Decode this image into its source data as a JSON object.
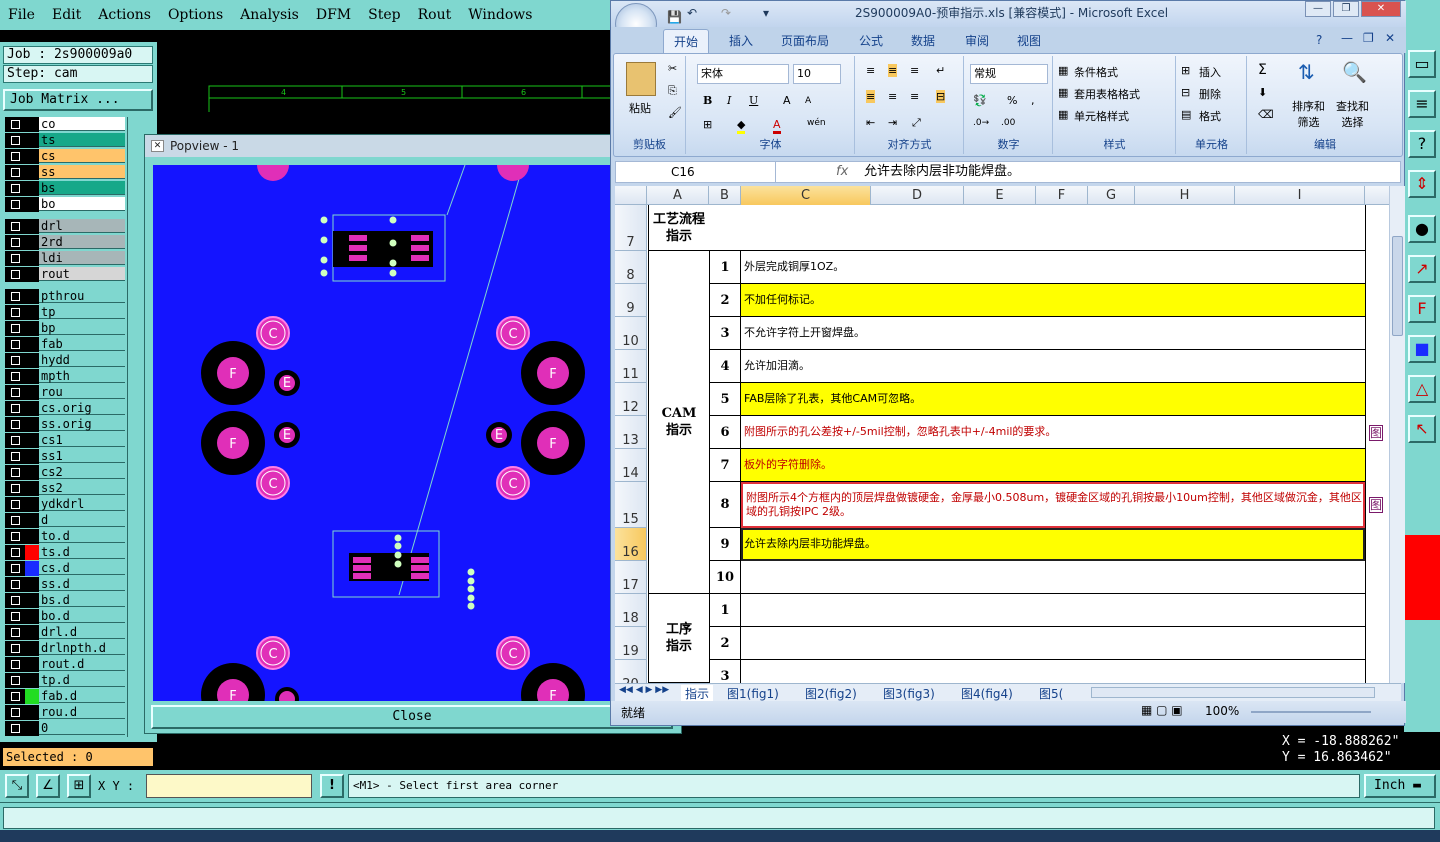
{
  "menubar": {
    "items": [
      "File",
      "Edit",
      "Actions",
      "Options",
      "Analysis",
      "DFM",
      "Step",
      "Rout",
      "Windows"
    ]
  },
  "job": {
    "job_label": "Job : 2s900009a0",
    "step_label": "Step: cam",
    "matrix_button": "Job Matrix ..."
  },
  "layers": [
    {
      "name": "co",
      "color": "#ffffff"
    },
    {
      "name": "ts",
      "color": "#17a889"
    },
    {
      "name": "cs",
      "color": "#ffc46b"
    },
    {
      "name": "ss",
      "color": "#ffc46b"
    },
    {
      "name": "bs",
      "color": "#17a889"
    },
    {
      "name": "bo",
      "color": "#ffffff"
    },
    {
      "name": "drl",
      "color": "#a7b6b8"
    },
    {
      "name": "2rd",
      "color": "#a7b6b8"
    },
    {
      "name": "ldi",
      "color": "#a7b6b8"
    },
    {
      "name": "rout",
      "color": "#d6d6d6"
    },
    {
      "name": "pthrou",
      "color": "#7fd7cf"
    },
    {
      "name": "tp",
      "color": "#7fd7cf"
    },
    {
      "name": "bp",
      "color": "#7fd7cf"
    },
    {
      "name": "fab",
      "color": "#7fd7cf",
      "pen": true
    },
    {
      "name": "hydd",
      "color": "#7fd7cf"
    },
    {
      "name": "mpth",
      "color": "#7fd7cf"
    },
    {
      "name": "rou",
      "color": "#7fd7cf",
      "pen": true
    },
    {
      "name": "cs.orig",
      "color": "#7fd7cf"
    },
    {
      "name": "ss.orig",
      "color": "#7fd7cf"
    },
    {
      "name": "cs1",
      "color": "#7fd7cf"
    },
    {
      "name": "ss1",
      "color": "#7fd7cf"
    },
    {
      "name": "cs2",
      "color": "#7fd7cf"
    },
    {
      "name": "ss2",
      "color": "#7fd7cf"
    },
    {
      "name": "ydkdrl",
      "color": "#7fd7cf"
    },
    {
      "name": "d",
      "color": "#7fd7cf"
    },
    {
      "name": "to.d",
      "color": "#7fd7cf"
    },
    {
      "name": "ts.d",
      "color": "#7fd7cf",
      "marker": "#ff0000"
    },
    {
      "name": "cs.d",
      "color": "#7fd7cf",
      "marker": "#1a2cff"
    },
    {
      "name": "ss.d",
      "color": "#7fd7cf"
    },
    {
      "name": "bs.d",
      "color": "#7fd7cf"
    },
    {
      "name": "bo.d",
      "color": "#7fd7cf"
    },
    {
      "name": "drl.d",
      "color": "#7fd7cf"
    },
    {
      "name": "drlnpth.d",
      "color": "#7fd7cf"
    },
    {
      "name": "rout.d",
      "color": "#7fd7cf"
    },
    {
      "name": "tp.d",
      "color": "#7fd7cf"
    },
    {
      "name": "fab.d",
      "color": "#7fd7cf",
      "marker": "#22dd22",
      "pen": true
    },
    {
      "name": "rou.d",
      "color": "#7fd7cf",
      "pen": true
    },
    {
      "name": "0",
      "color": "#7fd7cf"
    }
  ],
  "selected_label": "Selected : 0",
  "ruler": [
    "4",
    "5",
    "6"
  ],
  "popview": {
    "title": "Popview - 1",
    "close_label": "Close",
    "pad_labels": {
      "c": "C",
      "f": "F",
      "e": "E"
    }
  },
  "bottom": {
    "xy_label": "X Y :",
    "prompt": "<M1> - Select first area corner",
    "units": "Inch",
    "coord_x": "X = -18.888262\"",
    "coord_y": "Y = 16.863462\""
  },
  "excel": {
    "title": "2S900009A0-预审指示.xls  [兼容模式] - Microsoft Excel",
    "tabs": [
      "开始",
      "插入",
      "页面布局",
      "公式",
      "数据",
      "审阅",
      "视图"
    ],
    "groups": {
      "clipboard": "剪贴板",
      "font": "字体",
      "align": "对齐方式",
      "number": "数字",
      "style": "样式",
      "cells": "单元格",
      "edit": "编辑"
    },
    "paste": "粘贴",
    "font_name": "宋体",
    "font_size": "10",
    "number_format": "常规",
    "style_items": [
      "条件格式",
      "套用表格格式",
      "单元格样式"
    ],
    "cell_items": [
      "插入",
      "删除",
      "格式"
    ],
    "edit_items": [
      "排序和\n筛选",
      "查找和\n选择"
    ],
    "namebox": "C16",
    "fx": "fx",
    "formula": "允许去除内层非功能焊盘。",
    "columns": [
      "A",
      "B",
      "C",
      "D",
      "E",
      "F",
      "G",
      "H",
      "I"
    ],
    "rows": [
      {
        "num": "7",
        "h": "",
        "text": "",
        "fill": ""
      },
      {
        "num": "8",
        "h": "1",
        "text": "外层完成铜厚1OZ。",
        "fill": "",
        "color": "#000"
      },
      {
        "num": "9",
        "h": "2",
        "text": "不加任何标记。",
        "fill": "#ffff00",
        "color": "#000"
      },
      {
        "num": "10",
        "h": "3",
        "text": "不允许字符上开窗焊盘。",
        "fill": "",
        "color": "#000"
      },
      {
        "num": "11",
        "h": "4",
        "text": "允许加泪滴。",
        "fill": "",
        "color": "#000"
      },
      {
        "num": "12",
        "h": "5",
        "text": "FAB层除了孔表，其他CAM可忽略。",
        "fill": "#ffff00",
        "color": "#000"
      },
      {
        "num": "13",
        "h": "6",
        "text": "附图所示的孔公差按+/-5mil控制，忽略孔表中+/-4mil的要求。",
        "fill": "",
        "color": "#c00000",
        "tag": "图"
      },
      {
        "num": "14",
        "h": "7",
        "text": "板外的字符删除。",
        "fill": "#ffff00",
        "color": "#c00000"
      },
      {
        "num": "15",
        "h": "8",
        "text": "附图所示4个方框内的顶层焊盘做镀硬金，金厚最小0.508um，镀硬金区域的孔铜按最小10um控制，其他区域做沉金，其他区域的孔铜按IPC 2级。",
        "fill": "",
        "color": "#c00000",
        "tag": "图"
      },
      {
        "num": "16",
        "h": "9",
        "text": "允许去除内层非功能焊盘。",
        "fill": "#ffff00",
        "color": "#000"
      },
      {
        "num": "17",
        "h": "10",
        "text": "",
        "fill": ""
      },
      {
        "num": "18",
        "h": "1",
        "text": "",
        "fill": ""
      },
      {
        "num": "19",
        "h": "2",
        "text": "",
        "fill": ""
      },
      {
        "num": "20",
        "h": "3",
        "text": "",
        "fill": ""
      }
    ],
    "group_labels": {
      "process": "工艺流程\n指示",
      "cam": "CAM\n指示",
      "step": "工序\n指示"
    },
    "sheets": [
      "指示",
      "图1(fig1)",
      "图2(fig2)",
      "图3(fig3)",
      "图4(fig4)",
      "图5("
    ],
    "status": "就绪",
    "zoom": "100%"
  }
}
